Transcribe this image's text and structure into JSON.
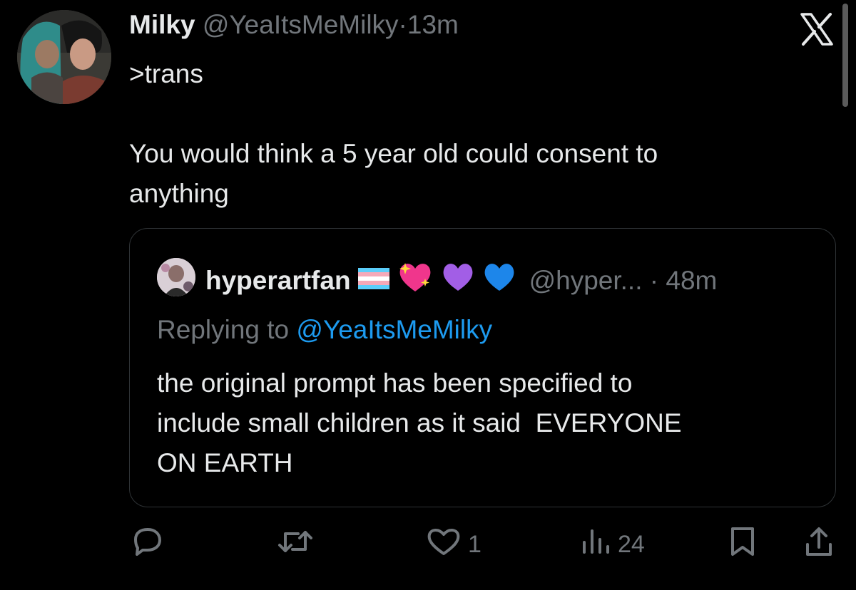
{
  "tweet": {
    "author_name": "Milky",
    "handle": "@YeaItsMeMilky",
    "separator": "·",
    "time": "13m",
    "text": ">trans\n\nYou would think a 5 year old could consent to\nanything"
  },
  "quote": {
    "author_name": "hyperartfan",
    "emojis": [
      "transgender-flag",
      "sparkling-heart",
      "purple-heart",
      "blue-heart"
    ],
    "handle": "@hyper...",
    "separator": "·",
    "time": "48m",
    "replying_prefix": "Replying to",
    "replying_to": "@YeaItsMeMilky",
    "text": "the original prompt has been specified to\ninclude small children as it said  EVERYONE\nON EARTH"
  },
  "actions": {
    "reply_count": "",
    "retweet_count": "",
    "like_count": "1",
    "views_count": "24"
  },
  "colors": {
    "background": "#000000",
    "text": "#e7e9ea",
    "secondary": "#71767b",
    "link": "#1d9bf0",
    "border": "#2f3336"
  }
}
